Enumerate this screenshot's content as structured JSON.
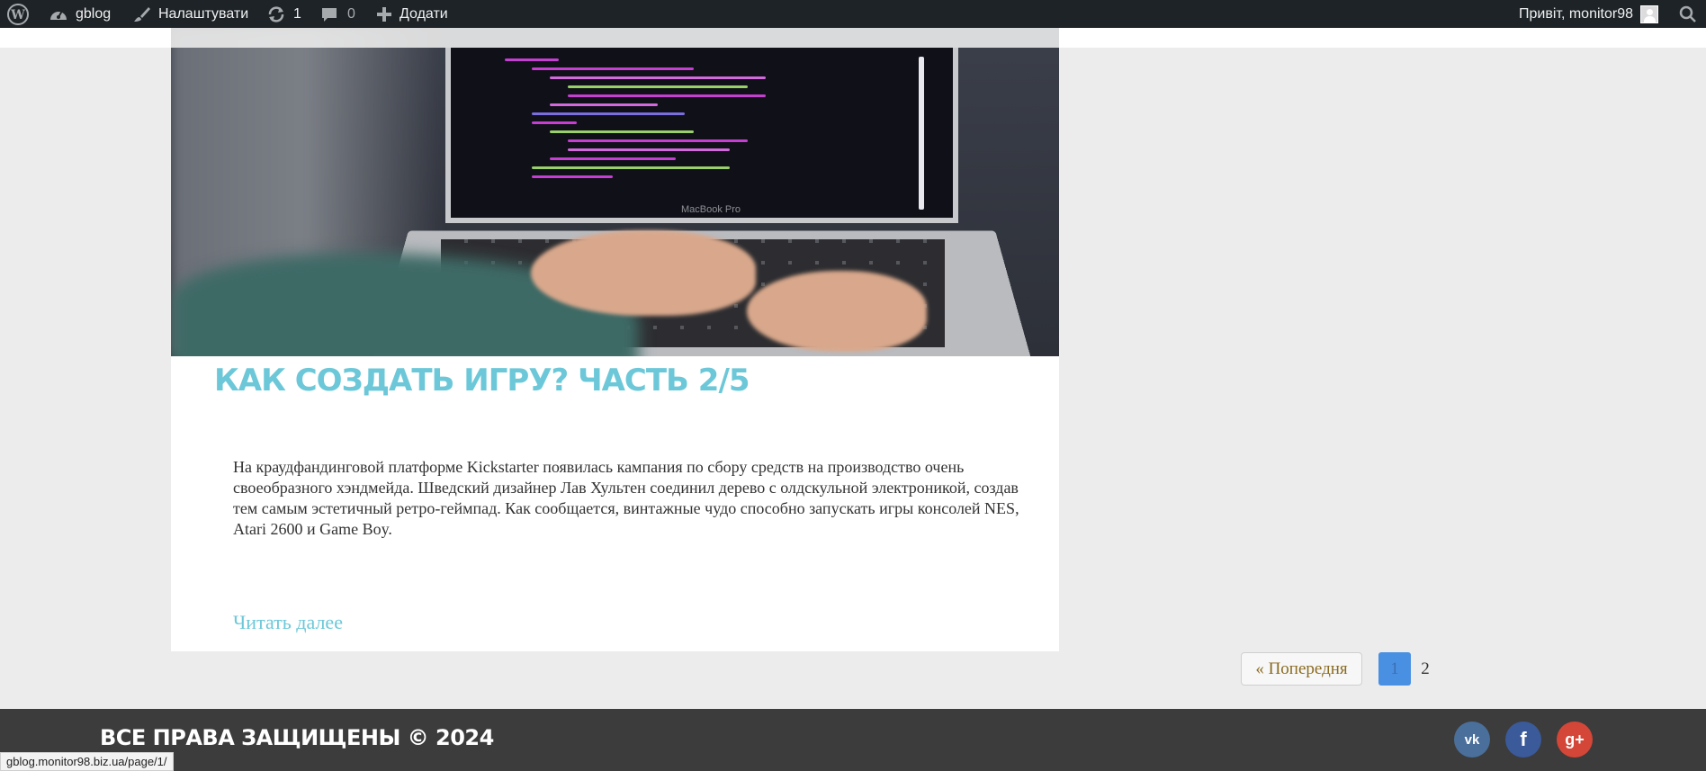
{
  "adminbar": {
    "site_name": "gblog",
    "customize": "Налаштувати",
    "updates_count": "1",
    "comments_count": "0",
    "add_new": "Додати",
    "greeting": "Привіт, monitor98"
  },
  "post": {
    "title": "Как создать игру? Часть 2/5",
    "excerpt": "На краудфандинговой платформе Kickstarter появилась кампания по сбору средств на производство очень своеобразного хэндмейда. Шведский дизайнер Лав Хультен соединил дерево с олдскульной электроникой, создав тем самым эстетичный ретро-геймпад. Как сообщается, винтажные чудо способно запускать игры консолей NES, Atari 2600 и Game Boy.",
    "read_more": "Читать далее",
    "image_caption_text": "MacBook Pro"
  },
  "pagination": {
    "prev": "« Попередня",
    "current": "1",
    "next": "2"
  },
  "footer": {
    "copyright": "ВСЕ ПРАВА ЗАЩИЩЕНЫ © 2024",
    "social": [
      "vk",
      "f",
      "g+"
    ]
  },
  "statusbar": {
    "url": "gblog.monitor98.biz.ua/page/1/"
  },
  "colors": {
    "accent": "#6cc8d8",
    "adminbar": "#1d2327",
    "footer": "#3c3c3c",
    "pager_current": "#4a90e2"
  }
}
